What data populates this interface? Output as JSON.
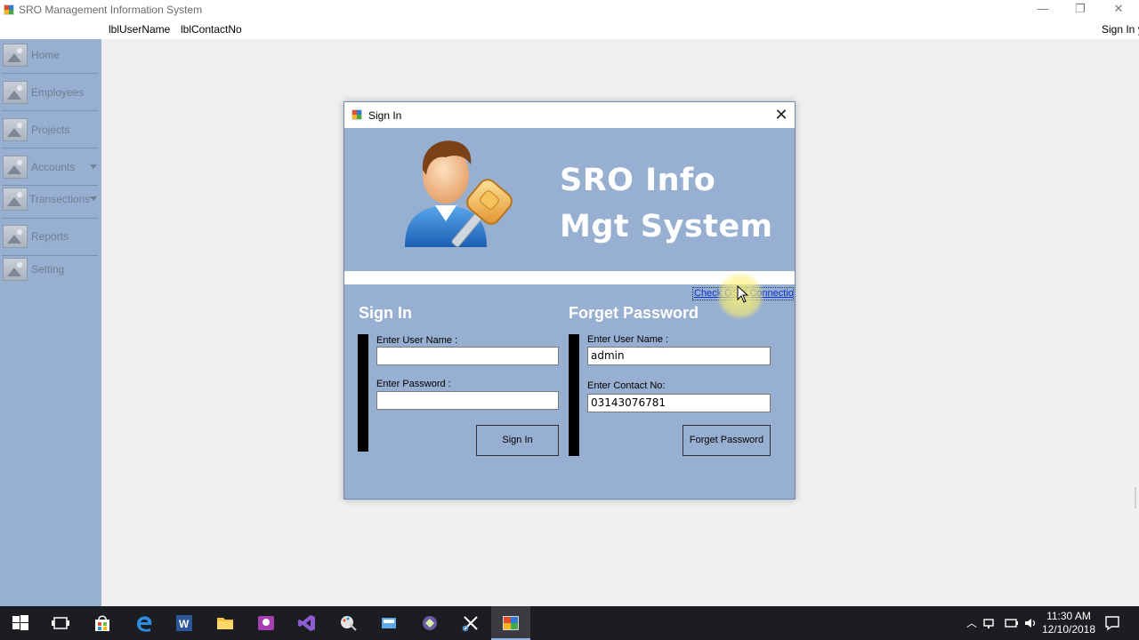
{
  "window": {
    "title": "SRO Management Information System",
    "controls": {
      "minimize": "—",
      "restore": "❐",
      "close": "✕"
    }
  },
  "menubar": {
    "user_name_label": "lblUserName",
    "contact_label": "lblContactNo",
    "sign_in_menu": "Sign In y"
  },
  "sidebar": {
    "items": [
      {
        "label": "Home",
        "icon": "image-placeholder-icon",
        "dropdown": false
      },
      {
        "label": "Employees",
        "icon": "image-placeholder-icon",
        "dropdown": false
      },
      {
        "label": "Projects",
        "icon": "image-placeholder-icon",
        "dropdown": false
      },
      {
        "label": "Accounts",
        "icon": "image-placeholder-icon",
        "dropdown": true
      },
      {
        "label": "Transections",
        "icon": "image-placeholder-icon",
        "dropdown": true
      },
      {
        "label": "Reports",
        "icon": "image-placeholder-icon",
        "dropdown": false
      },
      {
        "label": "Setting",
        "icon": "image-placeholder-icon",
        "dropdown": false
      }
    ]
  },
  "dialog": {
    "title": "Sign In",
    "close": "✕",
    "banner": {
      "line1": "SRO Info",
      "line2": "Mgt System",
      "icon": "user-key-icon"
    },
    "link": "Check GSM Connection",
    "sign_in": {
      "heading": "Sign In",
      "username_label": "Enter User Name :",
      "username_value": "",
      "password_label": "Enter Password :",
      "password_value": "",
      "button": "Sign In"
    },
    "forget": {
      "heading": "Forget Password",
      "username_label": "Enter User Name :",
      "username_value": "admin",
      "contact_label": "Enter Contact No:",
      "contact_value": "03143076781",
      "button": "Forget Password"
    }
  },
  "taskbar": {
    "icons": [
      "start-icon",
      "task-view-icon",
      "store-icon",
      "edge-icon",
      "word-icon",
      "file-explorer-icon",
      "teams-icon",
      "visual-studio-icon",
      "paint-icon",
      "calculator-icon",
      "tool-icon",
      "snipping-icon",
      "app-window-icon"
    ],
    "clock_time": "11:30 AM",
    "clock_date": "12/10/2018"
  },
  "colors": {
    "panel_blue": "#97afd0",
    "link_blue": "#0b2fd1",
    "taskbar": "#1c1d21"
  }
}
